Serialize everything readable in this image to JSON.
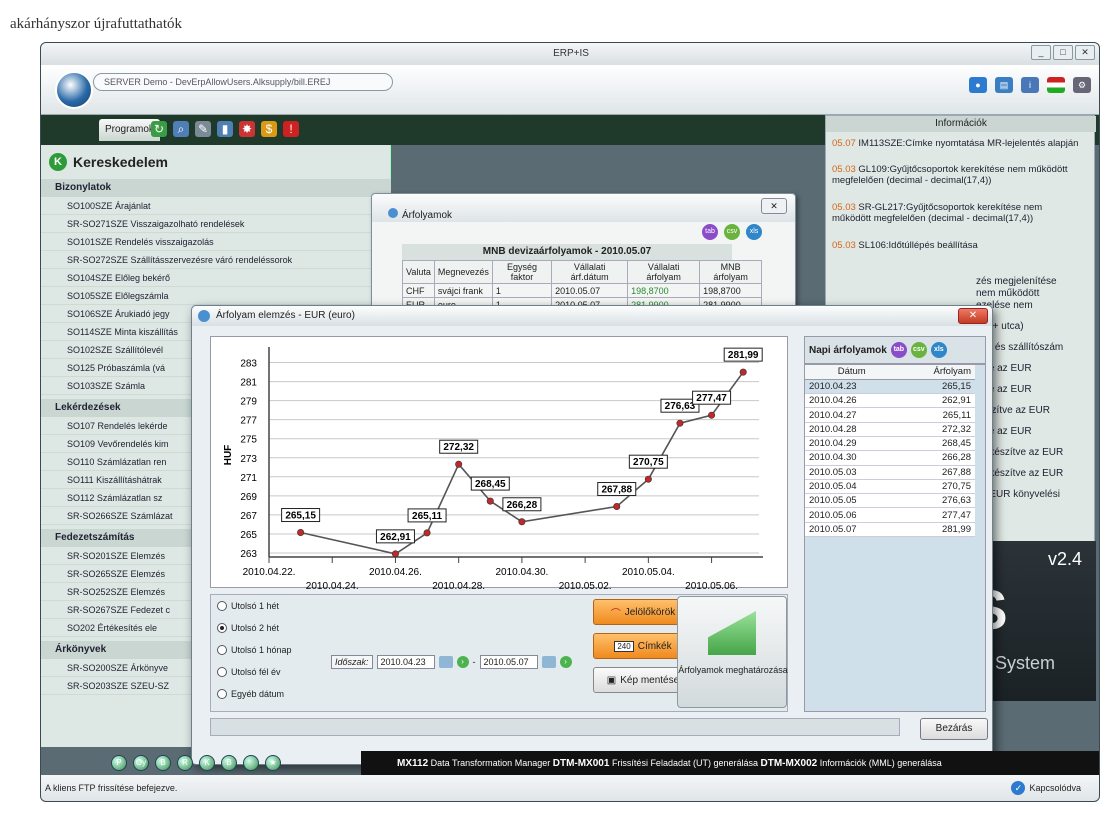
{
  "caption": "akárhányszor újrafuttathatók",
  "window": {
    "title": "ERP+IS",
    "controls": [
      "_",
      "□",
      "✕"
    ]
  },
  "header": {
    "address_text": "SERVER Demo - DevErpAllowUsers.Alksupply/bill.EREJ"
  },
  "toolbar": {
    "tab_label": "Programok"
  },
  "sidebar": {
    "title": "Kereskedelem",
    "badge": "K",
    "groups": [
      {
        "label": "Bizonylatok",
        "items": [
          "SO100SZE Árajánlat",
          "SR-SO271SZE Visszaigazolható rendelések",
          "SO101SZE Rendelés visszaigazolás",
          "SR-SO272SZE Szállításszervezésre váró rendeléssorok",
          "SO104SZE Előleg bekérő",
          "SO105SZE Előlegszámla",
          "SO106SZE Árukiadó jegy",
          "SO114SZE Minta kiszállítás",
          "SO102SZE Szállítólevél",
          "SO125 Próbaszámla (vá",
          "SO103SZE Számla"
        ]
      },
      {
        "label": "Lekérdezések",
        "items": [
          "SO107 Rendelés lekérde",
          "SO109 Vevőrendelés kim",
          "SO110 Számlázatlan ren",
          "SO111 Kiszállításhátrak",
          "SO112 Számlázatlan sz",
          "SR-SO266SZE Számlázat"
        ]
      },
      {
        "label": "Fedezetszámítás",
        "items": [
          "SR-SO201SZE Elemzés",
          "SR-SO265SZE Elemzés",
          "SR-SO252SZE Elemzés",
          "SR-SO267SZE Fedezet c",
          "SO202 Értékesítés ele"
        ]
      },
      {
        "label": "Árkönyvek",
        "items": [
          "SR-SO200SZE Árkönyve",
          "SR-SO203SZE SZEU-SZ"
        ]
      }
    ]
  },
  "info": {
    "title": "Információk",
    "rows": [
      {
        "date": "05.07",
        "text": "IM113SZE:Címke nyomtatása MR-lejelentés alapján"
      },
      {
        "date": "05.03",
        "text": "GL109:Gyűjtőcsoportok kerekítése nem működött megfelelően (decimal - decimal(17,4))"
      },
      {
        "date": "05.03",
        "text": "SR-GL217:Gyűjtőcsoportok kerekítése nem működött megfelelően (decimal - decimal(17,4))"
      },
      {
        "date": "05.03",
        "text": "SL106:Időtúllépés beállítása"
      }
    ],
    "cut_texts": [
      "zés megjelenítése",
      "nem működött",
      "ezelése nem",
      "ros + utca)",
      "kód és szállítószám",
      "zíve az EUR",
      "zíve az EUR",
      "készítve az EUR",
      "zíve az EUR",
      "tfelkészítve az EUR",
      "tfelkészítve az EUR",
      "az EUR könyvelési"
    ]
  },
  "brand": {
    "version": "v2.4",
    "text": "+IS",
    "subtext": "ion System"
  },
  "rates_window": {
    "title": "Árfolyamok",
    "close": "✕",
    "subtitle": "MNB devizaárfolyamok - 2010.05.07",
    "icons": [
      "tab",
      "csv",
      "xls"
    ],
    "headers": [
      "Valuta",
      "Megnevezés",
      "Egység faktor",
      "Vállalati árf.dátum",
      "Vállalati árfolyam",
      "MNB árfolyam"
    ],
    "rows": [
      [
        "CHF",
        "svájci frank",
        "1",
        "2010.05.07",
        "198,8700",
        "198,8700"
      ],
      [
        "EUR",
        "euro",
        "1",
        "2010.05.07",
        "281,9900",
        "281,9900"
      ]
    ]
  },
  "analysis": {
    "title": "Árfolyam elemzés - EUR (euro)",
    "close": "✕",
    "radios": [
      "Utolsó 1 hét",
      "Utolsó 2 hét",
      "Utolsó 1 hónap",
      "Utolsó fél év",
      "Egyéb dátum"
    ],
    "selected_radio": 1,
    "period_label": "Időszak:",
    "period_from": "2010.04.23",
    "period_sep": "-",
    "period_to": "2010.05.07",
    "buttons": {
      "markers": "Jelölőkörök",
      "labels": "Címkék",
      "save_image": "Kép mentése",
      "determine": "Árfolyamok meghatározása",
      "close": "Bezárás"
    },
    "daily": {
      "title": "Napi árfolyamok",
      "icons": [
        "tab",
        "csv",
        "xls"
      ],
      "col_date": "Dátum",
      "col_rate": "Árfolyam",
      "rows": [
        [
          "2010.04.23",
          "265,15"
        ],
        [
          "2010.04.26",
          "262,91"
        ],
        [
          "2010.04.27",
          "265,11"
        ],
        [
          "2010.04.28",
          "272,32"
        ],
        [
          "2010.04.29",
          "268,45"
        ],
        [
          "2010.04.30",
          "266,28"
        ],
        [
          "2010.05.03",
          "267,88"
        ],
        [
          "2010.05.04",
          "270,75"
        ],
        [
          "2010.05.05",
          "276,63"
        ],
        [
          "2010.05.06",
          "277,47"
        ],
        [
          "2010.05.07",
          "281,99"
        ]
      ]
    }
  },
  "chart_data": {
    "type": "line",
    "ylabel": "HUF",
    "ylim": [
      263,
      284
    ],
    "yticks": [
      263,
      265,
      267,
      269,
      271,
      273,
      275,
      277,
      279,
      281,
      283
    ],
    "xtick_labels": [
      "2010.04.22.",
      "2010.04.24.",
      "2010.04.26.",
      "2010.04.28.",
      "2010.04.30.",
      "2010.05.02.",
      "2010.05.04.",
      "2010.05.06."
    ],
    "xtick_days": [
      0,
      2,
      4,
      6,
      8,
      10,
      12,
      14
    ],
    "series": [
      {
        "points": [
          {
            "day": 1,
            "value": 265.15,
            "label": "265,15"
          },
          {
            "day": 4,
            "value": 262.91,
            "label": "262,91"
          },
          {
            "day": 5,
            "value": 265.11,
            "label": "265,11"
          },
          {
            "day": 6,
            "value": 272.32,
            "label": "272,32"
          },
          {
            "day": 7,
            "value": 268.45,
            "label": "268,45"
          },
          {
            "day": 8,
            "value": 266.28,
            "label": "266,28"
          },
          {
            "day": 11,
            "value": 267.88,
            "label": "267,88"
          },
          {
            "day": 12,
            "value": 270.75,
            "label": "270,75"
          },
          {
            "day": 13,
            "value": 276.63,
            "label": "276,63"
          },
          {
            "day": 14,
            "value": 277.47,
            "label": "277,47"
          },
          {
            "day": 15,
            "value": 281.99,
            "label": "281,99"
          }
        ]
      }
    ],
    "grid": true,
    "marker_color": "#c0282a",
    "line_color": "#555555"
  },
  "bottom_icons": [
    "P",
    "Oy",
    "B",
    "R",
    "K",
    "B",
    "",
    "★"
  ],
  "news": {
    "items": [
      {
        "code": "MX112",
        "text": "Data Transformation Manager"
      },
      {
        "code": "DTM-MX001",
        "text": "Frissítési Feladadat (UT) generálása"
      },
      {
        "code": "DTM-MX002",
        "text": "Információk (MML) generálása"
      }
    ]
  },
  "status": {
    "message": "A kliens FTP frissítése befejezve.",
    "connected": "Kapcsolódva"
  }
}
